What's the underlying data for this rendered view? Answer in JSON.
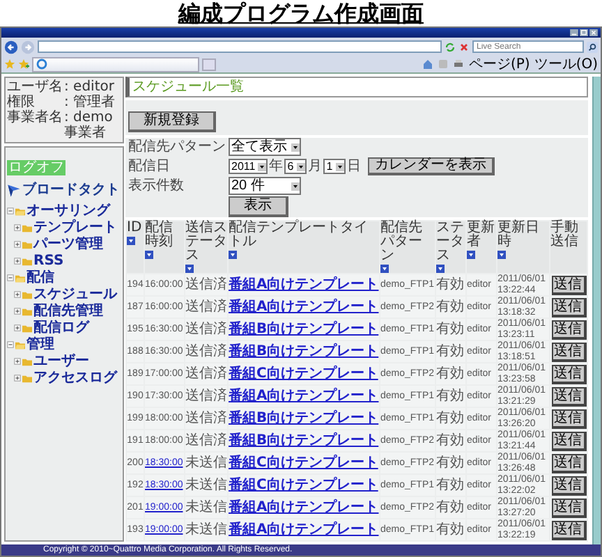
{
  "heading": "編成プログラム作成画面",
  "browser": {
    "search_placeholder": "Live Search",
    "menus": [
      "ページ(P)",
      "ツール(O)"
    ]
  },
  "user_info": [
    {
      "label": "ユーザ名",
      "value": ": editor"
    },
    {
      "label": "権限",
      "value": ": 管理者"
    },
    {
      "label": "事業者名",
      "value": ": demo事業者"
    }
  ],
  "logoff": "ログオフ",
  "logo_text": "ブロードタクト",
  "nav_tree": [
    {
      "label": "オーサリング",
      "expanded": true,
      "children": [
        {
          "label": "テンプレート",
          "expanded": false
        },
        {
          "label": "パーツ管理",
          "expanded": false
        },
        {
          "label": "RSS",
          "expanded": false
        }
      ]
    },
    {
      "label": "配信",
      "expanded": true,
      "children": [
        {
          "label": "スケジュール",
          "expanded": false
        },
        {
          "label": "配信先管理",
          "expanded": false
        },
        {
          "label": "配信ログ",
          "expanded": false
        }
      ]
    },
    {
      "label": "管理",
      "expanded": true,
      "children": [
        {
          "label": "ユーザー",
          "expanded": false
        },
        {
          "label": "アクセスログ",
          "expanded": false
        }
      ]
    }
  ],
  "page_title": "スケジュール一覧",
  "new_button": "新規登録",
  "filters": [
    {
      "kind": "select",
      "label": "配信先パターン",
      "value": "全て表示"
    },
    {
      "kind": "date",
      "label": "配信日",
      "year": "2011",
      "year_unit": "年",
      "month": "6",
      "month_unit": "月",
      "day": "1",
      "day_unit": "日",
      "calendar_button": "カレンダーを表示"
    },
    {
      "kind": "select",
      "label": "表示件数",
      "value": "20 件"
    }
  ],
  "show_button": "表示",
  "table": {
    "columns": [
      {
        "label": "ID",
        "sortable": true
      },
      {
        "label": "配信時刻",
        "sortable": true
      },
      {
        "label": "送信ステータス",
        "sortable": true
      },
      {
        "label": "配信テンプレートタイトル",
        "sortable": true
      },
      {
        "label": "配信先パターン",
        "sortable": true
      },
      {
        "label": "ステータス",
        "sortable": true
      },
      {
        "label": "更新者",
        "sortable": true
      },
      {
        "label": "更新日時",
        "sortable": true
      },
      {
        "label": "手動送信",
        "sortable": false
      }
    ],
    "rows": [
      {
        "id": "194",
        "time": "16:00:00",
        "time_linked": false,
        "send_status": "送信済",
        "template": "番組A向けテンプレート",
        "pattern": "demo_FTP1",
        "status": "有効",
        "updater": "editor",
        "updated": "2011/06/01 13:22:44",
        "button": "送信"
      },
      {
        "id": "187",
        "time": "16:00:00",
        "time_linked": false,
        "send_status": "送信済",
        "template": "番組A向けテンプレート",
        "pattern": "demo_FTP2",
        "status": "有効",
        "updater": "editor",
        "updated": "2011/06/01 13:18:32",
        "button": "送信"
      },
      {
        "id": "195",
        "time": "16:30:00",
        "time_linked": false,
        "send_status": "送信済",
        "template": "番組B向けテンプレート",
        "pattern": "demo_FTP1",
        "status": "有効",
        "updater": "editor",
        "updated": "2011/06/01 13:23:11",
        "button": "送信"
      },
      {
        "id": "188",
        "time": "16:30:00",
        "time_linked": false,
        "send_status": "送信済",
        "template": "番組B向けテンプレート",
        "pattern": "demo_FTP1",
        "status": "有効",
        "updater": "editor",
        "updated": "2011/06/01 13:18:51",
        "button": "送信"
      },
      {
        "id": "189",
        "time": "17:00:00",
        "time_linked": false,
        "send_status": "送信済",
        "template": "番組C向けテンプレート",
        "pattern": "demo_FTP2",
        "status": "有効",
        "updater": "editor",
        "updated": "2011/06/01 13:23:58",
        "button": "送信"
      },
      {
        "id": "190",
        "time": "17:30:00",
        "time_linked": false,
        "send_status": "送信済",
        "template": "番組A向けテンプレート",
        "pattern": "demo_FTP1",
        "status": "有効",
        "updater": "editor",
        "updated": "2011/06/01 13:21:29",
        "button": "送信"
      },
      {
        "id": "199",
        "time": "18:00:00",
        "time_linked": false,
        "send_status": "送信済",
        "template": "番組B向けテンプレート",
        "pattern": "demo_FTP1",
        "status": "有効",
        "updater": "editor",
        "updated": "2011/06/01 13:26:20",
        "button": "送信"
      },
      {
        "id": "191",
        "time": "18:00:00",
        "time_linked": false,
        "send_status": "送信済",
        "template": "番組B向けテンプレート",
        "pattern": "demo_FTP2",
        "status": "有効",
        "updater": "editor",
        "updated": "2011/06/01 13:21:44",
        "button": "送信"
      },
      {
        "id": "200",
        "time": "18:30:00",
        "time_linked": true,
        "send_status": "未送信",
        "template": "番組C向けテンプレート",
        "pattern": "demo_FTP2",
        "status": "有効",
        "updater": "editor",
        "updated": "2011/06/01 13:26:48",
        "button": "送信"
      },
      {
        "id": "192",
        "time": "18:30:00",
        "time_linked": true,
        "send_status": "未送信",
        "template": "番組C向けテンプレート",
        "pattern": "demo_FTP1",
        "status": "有効",
        "updater": "editor",
        "updated": "2011/06/01 13:22:02",
        "button": "送信"
      },
      {
        "id": "201",
        "time": "19:00:00",
        "time_linked": true,
        "send_status": "未送信",
        "template": "番組A向けテンプレート",
        "pattern": "demo_FTP2",
        "status": "有効",
        "updater": "editor",
        "updated": "2011/06/01 13:27:20",
        "button": "送信"
      },
      {
        "id": "193",
        "time": "19:00:00",
        "time_linked": true,
        "send_status": "未送信",
        "template": "番組A向けテンプレート",
        "pattern": "demo_FTP1",
        "status": "有効",
        "updater": "editor",
        "updated": "2011/06/01 13:22:19",
        "button": "送信"
      }
    ]
  },
  "footer": "Copyright © 2010~Quattro Media Corporation. All Rights Reserved."
}
